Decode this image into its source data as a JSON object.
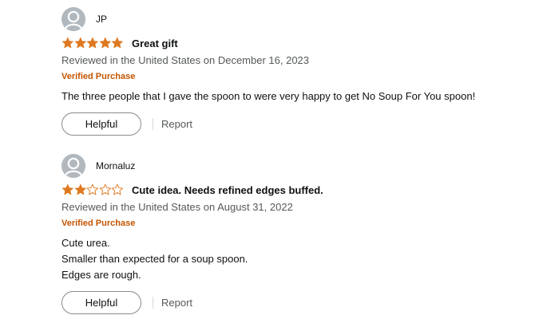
{
  "colors": {
    "star_filled": "#de7921",
    "star_outline": "#de7921",
    "verified": "#c45500",
    "secondary_text": "#565959",
    "avatar_bg": "#b1b9bf"
  },
  "reviews": [
    {
      "profile_name": "JP",
      "rating": 5,
      "rating_max": 5,
      "title": "Great gift",
      "date": "Reviewed in the United States on December 16, 2023",
      "verified": "Verified Purchase",
      "body": [
        "The three people that I gave the spoon to were very happy to get No Soup For You spoon!"
      ],
      "helpful_label": "Helpful",
      "report_label": "Report"
    },
    {
      "profile_name": "Mornaluz",
      "rating": 2,
      "rating_max": 5,
      "title": "Cute idea. Needs refined edges buffed.",
      "date": "Reviewed in the United States on August 31, 2022",
      "verified": "Verified Purchase",
      "body": [
        "Cute urea.",
        "Smaller than expected for a soup spoon.",
        "Edges are rough."
      ],
      "helpful_label": "Helpful",
      "report_label": "Report"
    }
  ]
}
